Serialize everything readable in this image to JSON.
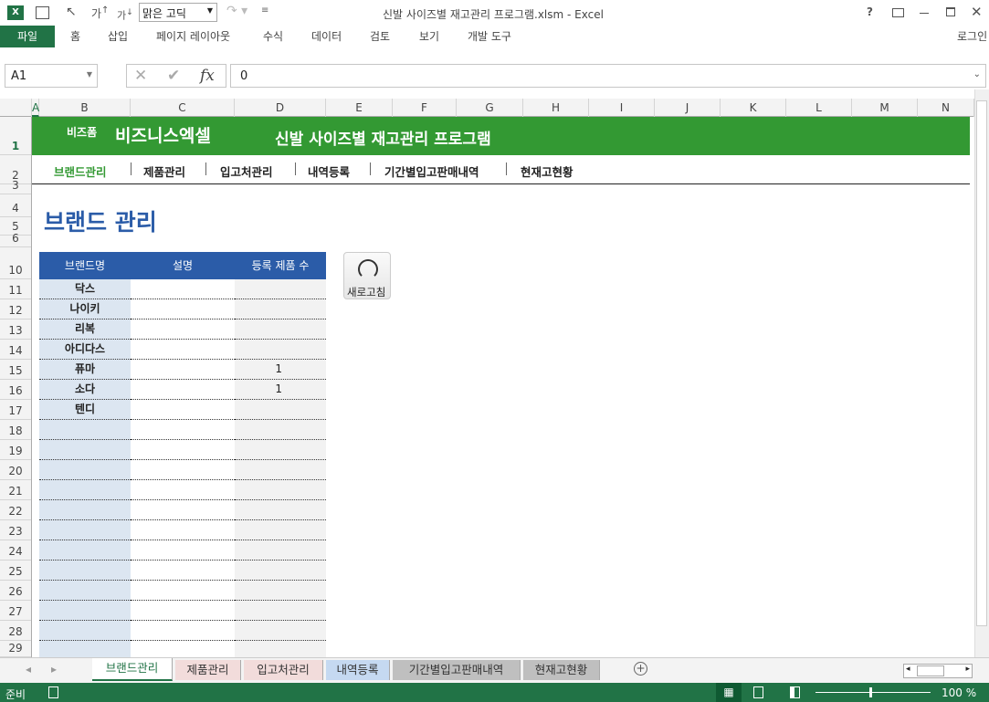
{
  "app": {
    "title": "신발 사이즈별 재고관리 프로그램.xlsm - Excel",
    "font_box": "맑은 고딕",
    "help": "?",
    "login": "로그인"
  },
  "ribbon": {
    "tabs": [
      "파일",
      "홈",
      "삽입",
      "페이지 레이아웃",
      "수식",
      "데이터",
      "검토",
      "보기",
      "개발 도구"
    ]
  },
  "formula": {
    "name_box": "A1",
    "value": "0",
    "fx": "fx"
  },
  "columns": [
    "A",
    "B",
    "C",
    "D",
    "E",
    "F",
    "G",
    "H",
    "I",
    "J",
    "K",
    "L",
    "M",
    "N"
  ],
  "rows": [
    "1",
    "2",
    "3",
    "4",
    "5",
    "6",
    "10",
    "11",
    "12",
    "13",
    "14",
    "15",
    "16",
    "17",
    "18",
    "19",
    "20",
    "21",
    "22",
    "23",
    "24",
    "25",
    "26",
    "27",
    "28",
    "29"
  ],
  "banner": {
    "brand_small": "비즈폼",
    "brand": "비즈니스엑셀",
    "title": "신발 사이즈별 재고관리 프로그램"
  },
  "nav": [
    "브랜드관리",
    "제품관리",
    "입고처관리",
    "내역등록",
    "기간별입고판매내역",
    "현재고현황"
  ],
  "page_title": "브랜드 관리",
  "table": {
    "headers": [
      "브랜드명",
      "설명",
      "등록 제품 수"
    ],
    "rows": [
      [
        "닥스",
        "",
        ""
      ],
      [
        "나이키",
        "",
        ""
      ],
      [
        "리복",
        "",
        ""
      ],
      [
        "아디다스",
        "",
        ""
      ],
      [
        "퓨마",
        "",
        "1"
      ],
      [
        "소다",
        "",
        "1"
      ],
      [
        "텐디",
        "",
        ""
      ],
      [
        "",
        "",
        ""
      ],
      [
        "",
        "",
        ""
      ],
      [
        "",
        "",
        ""
      ],
      [
        "",
        "",
        ""
      ],
      [
        "",
        "",
        ""
      ],
      [
        "",
        "",
        ""
      ],
      [
        "",
        "",
        ""
      ],
      [
        "",
        "",
        ""
      ],
      [
        "",
        "",
        ""
      ],
      [
        "",
        "",
        ""
      ],
      [
        "",
        "",
        ""
      ],
      [
        "",
        "",
        ""
      ]
    ]
  },
  "refresh_button": "새로고침",
  "sheet_tabs": [
    {
      "label": "브랜드관리",
      "color": "#ffffff"
    },
    {
      "label": "제품관리",
      "color": "#f2dcdb"
    },
    {
      "label": "입고처관리",
      "color": "#f2dcdb"
    },
    {
      "label": "내역등록",
      "color": "#c5d9f1"
    },
    {
      "label": "기간별입고판매내역",
      "color": "#bfbfbf"
    },
    {
      "label": "현재고현황",
      "color": "#bfbfbf"
    }
  ],
  "status": {
    "ready": "준비",
    "zoom": "100 %"
  },
  "colors": {
    "green": "#339933",
    "excel": "#217346",
    "header_blue": "#2b5ca8",
    "title_blue": "#2b5ca8"
  }
}
